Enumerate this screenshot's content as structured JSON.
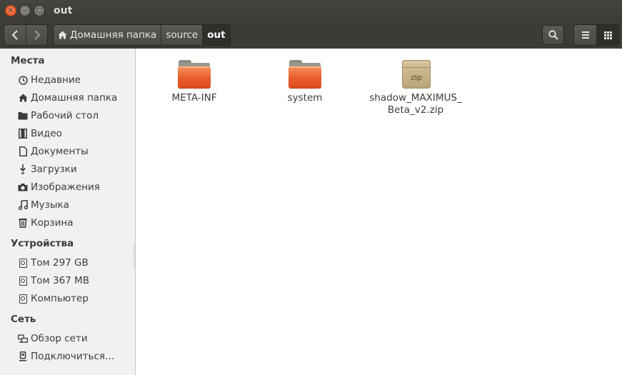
{
  "window": {
    "title": "out"
  },
  "titlebar": {
    "close_glyph": "×",
    "minimize_glyph": "–",
    "maximize_glyph": "□"
  },
  "toolbar": {
    "back_icon": "‹",
    "forward_icon": "›",
    "breadcrumbs": [
      {
        "label": "Домашняя папка",
        "icon": "home-icon"
      },
      {
        "label": "source"
      },
      {
        "label": "out",
        "active": true
      }
    ],
    "search_icon": "magnifier",
    "list_view_icon": "list",
    "grid_view_icon": "grid"
  },
  "sidebar": {
    "places_title": "Места",
    "places": [
      {
        "label": "Недавние",
        "icon": "clock-icon"
      },
      {
        "label": "Домашняя папка",
        "icon": "home-icon"
      },
      {
        "label": "Рабочий стол",
        "icon": "desktop-folder-icon"
      },
      {
        "label": "Видео",
        "icon": "film-icon"
      },
      {
        "label": "Документы",
        "icon": "document-icon"
      },
      {
        "label": "Загрузки",
        "icon": "download-icon"
      },
      {
        "label": "Изображения",
        "icon": "camera-icon"
      },
      {
        "label": "Музыка",
        "icon": "music-icon"
      },
      {
        "label": "Корзина",
        "icon": "trash-icon"
      }
    ],
    "devices_title": "Устройства",
    "devices": [
      {
        "label": "Том 297 GB",
        "icon": "drive-icon"
      },
      {
        "label": "Том 367 MB",
        "icon": "drive-icon"
      },
      {
        "label": "Компьютер",
        "icon": "drive-icon"
      }
    ],
    "network_title": "Сеть",
    "network": [
      {
        "label": "Обзор сети",
        "icon": "network-icon"
      },
      {
        "label": "Подключиться…",
        "icon": "server-icon"
      }
    ]
  },
  "files": [
    {
      "name": "META-INF",
      "type": "folder"
    },
    {
      "name": "system",
      "type": "folder"
    },
    {
      "name_line1": "shadow_MAXIMUS_",
      "name_line2": "Beta_v2.zip",
      "type": "zip",
      "badge": "zip"
    }
  ],
  "colors": {
    "folder": "#e8592a",
    "titlebar": "#3c3b37",
    "close_button": "#e24f19"
  }
}
